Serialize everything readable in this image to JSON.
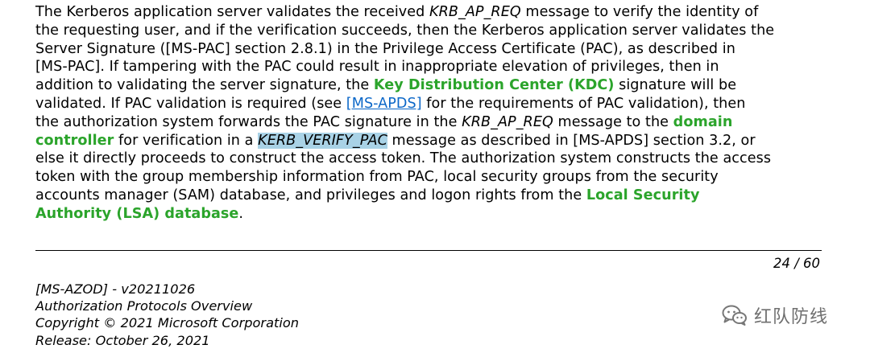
{
  "document": {
    "lines": [
      [
        {
          "t": "The Kerberos application server validates the received "
        },
        {
          "t": "KRB_AP_REQ",
          "style": "italic"
        },
        {
          "t": " message to verify the identity of"
        }
      ],
      [
        {
          "t": "the requesting user, and if the verification succeeds, then the Kerberos application server validates the"
        }
      ],
      [
        {
          "t": "Server Signature ([MS-PAC] section 2.8.1) in the Privilege Access Certificate (PAC), as described in"
        }
      ],
      [
        {
          "t": "[MS-PAC]. If tampering with the PAC could result in inappropriate elevation of privileges, then in"
        }
      ],
      [
        {
          "t": "addition to validating the server signature, the "
        },
        {
          "t": "Key Distribution Center (KDC)",
          "style": "term"
        },
        {
          "t": " signature will be"
        }
      ],
      [
        {
          "t": "validated. If PAC validation is required (see "
        },
        {
          "t": "[MS-APDS]",
          "style": "link"
        },
        {
          "t": " for the requirements of PAC validation), then"
        }
      ],
      [
        {
          "t": "the authorization system forwards the PAC signature in the "
        },
        {
          "t": "KRB_AP_REQ",
          "style": "italic"
        },
        {
          "t": " message to the "
        },
        {
          "t": "domain",
          "style": "term"
        }
      ],
      [
        {
          "t": "controller",
          "style": "term"
        },
        {
          "t": " for verification in a "
        },
        {
          "t": "KERB_VERIFY_PAC",
          "style": "highlight"
        },
        {
          "t": " message as described in [MS-APDS] section 3.2, or"
        }
      ],
      [
        {
          "t": "else it directly proceeds to construct the access token. The authorization system constructs the access"
        }
      ],
      [
        {
          "t": "token with the group membership information from PAC, local security groups from the security"
        }
      ],
      [
        {
          "t": "accounts manager (SAM) database, and privileges and logon rights from the "
        },
        {
          "t": "Local Security",
          "style": "term"
        }
      ],
      [
        {
          "t": "Authority (LSA) database",
          "style": "term"
        },
        {
          "t": "."
        }
      ]
    ]
  },
  "page_number": "24 / 60",
  "footer": {
    "doc_id": "[MS-AZOD] - v20211026",
    "title": "Authorization Protocols Overview",
    "copyright": "Copyright © 2021 Microsoft Corporation",
    "release": "Release: October 26, 2021"
  },
  "watermark": {
    "text": "红队防线",
    "icon": "wechat-icon"
  },
  "colors": {
    "term": "#2ba42b",
    "link": "#0b67c8",
    "highlight": "#a9d2e6",
    "watermark": "#6f6f6f"
  }
}
